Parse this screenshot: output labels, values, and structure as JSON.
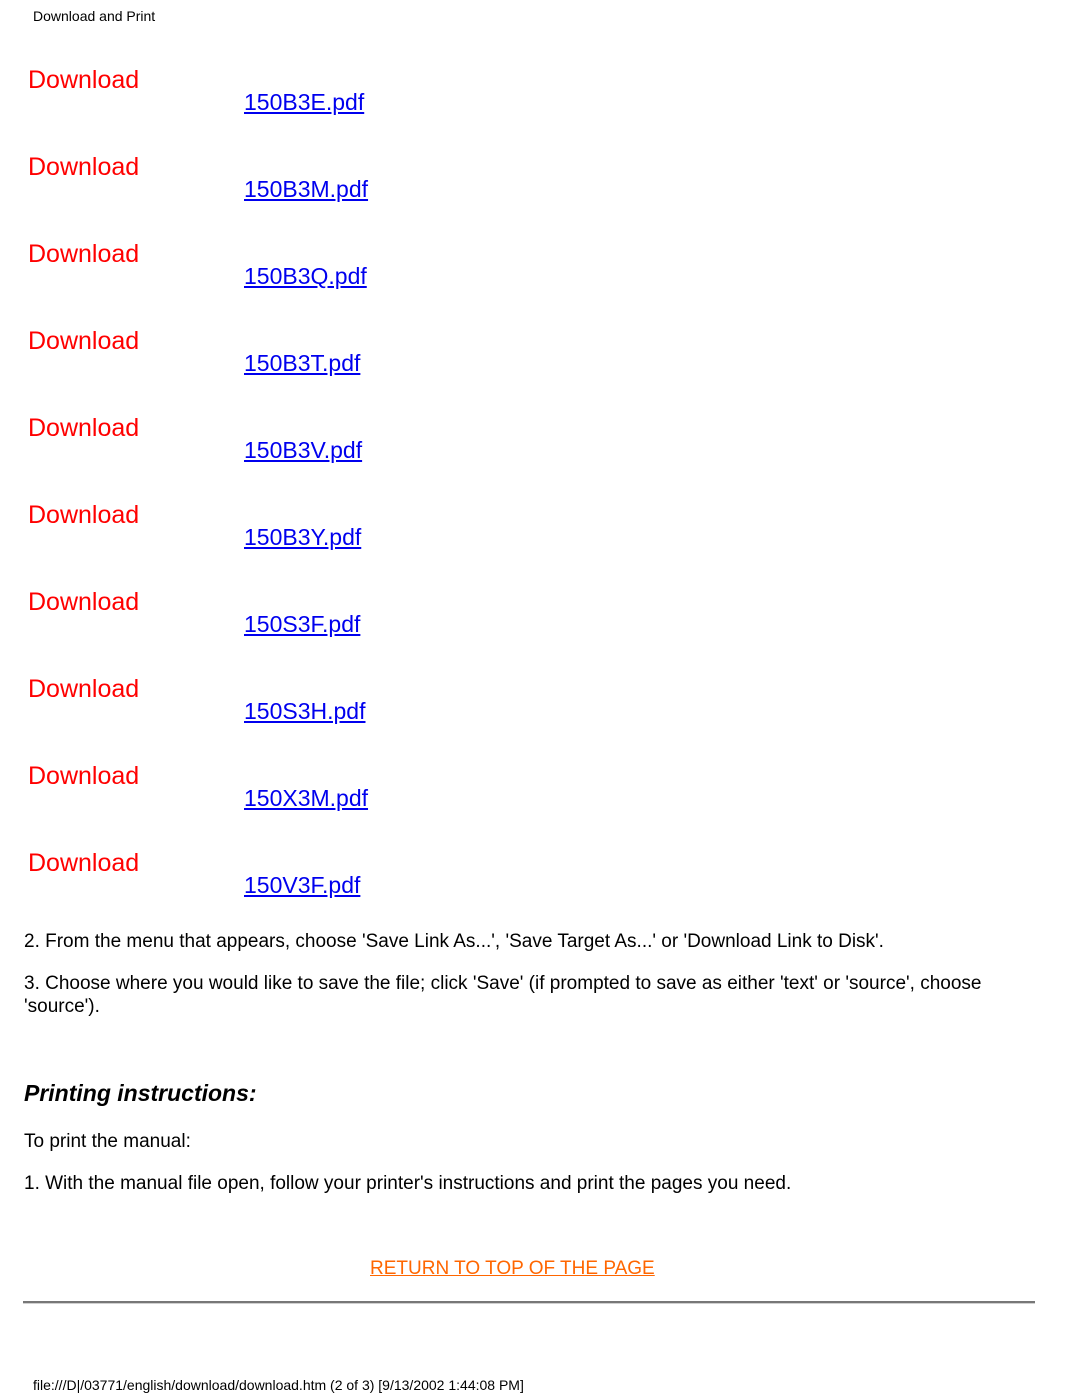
{
  "header": {
    "title": "Download and Print"
  },
  "downloads": [
    {
      "label": "Download",
      "file": "150B3E.pdf"
    },
    {
      "label": "Download",
      "file": "150B3M.pdf"
    },
    {
      "label": "Download",
      "file": "150B3Q.pdf"
    },
    {
      "label": "Download",
      "file": "150B3T.pdf"
    },
    {
      "label": "Download",
      "file": "150B3V.pdf"
    },
    {
      "label": "Download",
      "file": "150B3Y.pdf"
    },
    {
      "label": "Download",
      "file": "150S3F.pdf"
    },
    {
      "label": "Download",
      "file": "150S3H.pdf"
    },
    {
      "label": "Download",
      "file": "150X3M.pdf"
    },
    {
      "label": "Download",
      "file": "150V3F.pdf"
    }
  ],
  "steps": {
    "step2": "2. From the menu that appears, choose 'Save Link As...', 'Save Target As...' or 'Download Link to Disk'.",
    "step3": "3. Choose where you would like to save the file; click 'Save' (if prompted to save as either 'text' or 'source', choose 'source')."
  },
  "printing": {
    "title": "Printing instructions:",
    "intro": "To print the manual:",
    "step1": "1. With the manual file open, follow your printer's instructions and print the pages you need."
  },
  "return_link": "RETURN TO TOP OF THE PAGE",
  "footer": "file:///D|/03771/english/download/download.htm (2 of 3) [9/13/2002 1:44:08 PM]",
  "colors": {
    "download_label": "#ff0000",
    "file_link": "#0000ee",
    "return_link": "#ff6600"
  }
}
